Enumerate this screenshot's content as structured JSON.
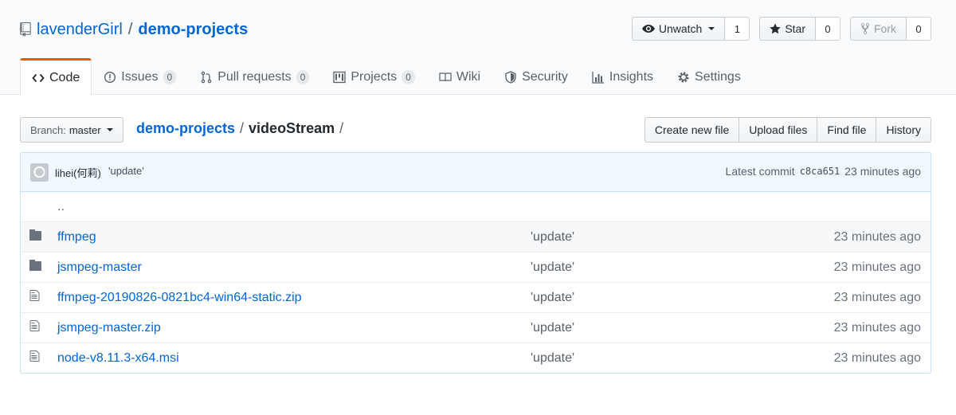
{
  "repo": {
    "owner": "lavenderGirl",
    "separator": "/",
    "name": "demo-projects"
  },
  "actions": {
    "watch": {
      "label": "Unwatch",
      "count": "1"
    },
    "star": {
      "label": "Star",
      "count": "0"
    },
    "fork": {
      "label": "Fork",
      "count": "0"
    }
  },
  "tabs": [
    {
      "label": "Code",
      "icon": "code-icon",
      "selected": true
    },
    {
      "label": "Issues",
      "icon": "issue-icon",
      "count": "0"
    },
    {
      "label": "Pull requests",
      "icon": "pull-request-icon",
      "count": "0"
    },
    {
      "label": "Projects",
      "icon": "project-icon",
      "count": "0"
    },
    {
      "label": "Wiki",
      "icon": "book-icon"
    },
    {
      "label": "Security",
      "icon": "shield-icon"
    },
    {
      "label": "Insights",
      "icon": "graph-icon"
    },
    {
      "label": "Settings",
      "icon": "gear-icon"
    }
  ],
  "file_nav": {
    "branch_label": "Branch:",
    "branch_name": "master",
    "breadcrumb_root": "demo-projects",
    "breadcrumb_sep": "/",
    "breadcrumb_current": "videoStream",
    "breadcrumb_trailing": "/",
    "buttons": [
      "Create new file",
      "Upload files",
      "Find file",
      "History"
    ]
  },
  "commit": {
    "author": "lihei(何莉)",
    "message": "'update'",
    "latest_label": "Latest commit",
    "sha": "c8ca651",
    "age": "23 minutes ago"
  },
  "files": {
    "parent_dir": "..",
    "rows": [
      {
        "type": "folder",
        "name": "ffmpeg",
        "message": "'update'",
        "age": "23 minutes ago"
      },
      {
        "type": "folder",
        "name": "jsmpeg-master",
        "message": "'update'",
        "age": "23 minutes ago"
      },
      {
        "type": "file",
        "name": "ffmpeg-20190826-0821bc4-win64-static.zip",
        "message": "'update'",
        "age": "23 minutes ago"
      },
      {
        "type": "file",
        "name": "jsmpeg-master.zip",
        "message": "'update'",
        "age": "23 minutes ago"
      },
      {
        "type": "file",
        "name": "node-v8.11.3-x64.msi",
        "message": "'update'",
        "age": "23 minutes ago"
      }
    ]
  },
  "colors": {
    "link": "#0366d6",
    "selected_tab_accent": "#e36209",
    "commit_bg": "#f1f8ff",
    "folder_icon": "#79b8ff",
    "file_icon": "#6a737d"
  }
}
